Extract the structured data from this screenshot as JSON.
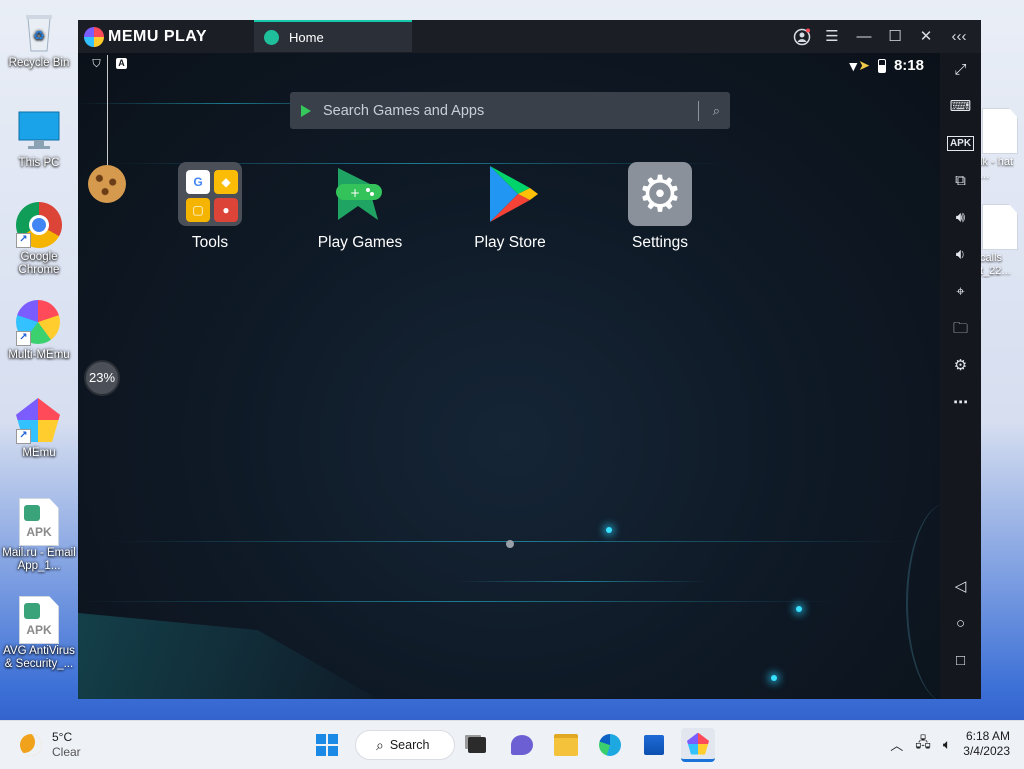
{
  "desktop": {
    "icons": [
      {
        "label": "Recycle Bin",
        "icon": "recycle-bin-icon"
      },
      {
        "label": "This PC",
        "icon": "monitor-icon"
      },
      {
        "label": "Google Chrome",
        "icon": "chrome-icon"
      },
      {
        "label": "Multi-MEmu",
        "icon": "multi-memu-icon"
      },
      {
        "label": "MEmu",
        "icon": "memu-icon"
      },
      {
        "label": "Mail.ru - Email App_1...",
        "icon": "apk-file-icon",
        "badge": "APK"
      },
      {
        "label": "AVG AntiVirus & Security_...",
        "icon": "apk-file-icon",
        "badge": "APK"
      }
    ],
    "right_partial": [
      {
        "label": "lk - hat ..."
      },
      {
        "label": "calls t_22..."
      }
    ]
  },
  "memu_window": {
    "logo_text": "MEMU PLAY",
    "tab_label": "Home",
    "status_time": "8:18",
    "search_placeholder": "Search Games and Apps",
    "apps": [
      {
        "label": "Tools",
        "icon": "tools-folder-icon"
      },
      {
        "label": "Play Games",
        "icon": "play-games-icon"
      },
      {
        "label": "Play Store",
        "icon": "play-store-icon"
      },
      {
        "label": "Settings",
        "icon": "settings-gear-icon"
      }
    ],
    "performance_badge": "23%",
    "sidebar_buttons": [
      "fullscreen",
      "keyboard",
      "apk",
      "multi-instance",
      "volume-up",
      "volume-down",
      "location",
      "folder",
      "settings",
      "more",
      "back",
      "home",
      "recents"
    ],
    "sidebar_apk_text": "APK",
    "colors": {
      "accent": "#14c9a9",
      "screen_bg": "#0f1a27"
    }
  },
  "taskbar": {
    "weather_temp": "5°C",
    "weather_desc": "Clear",
    "search_label": "Search",
    "time": "6:18 AM",
    "date": "3/4/2023"
  }
}
